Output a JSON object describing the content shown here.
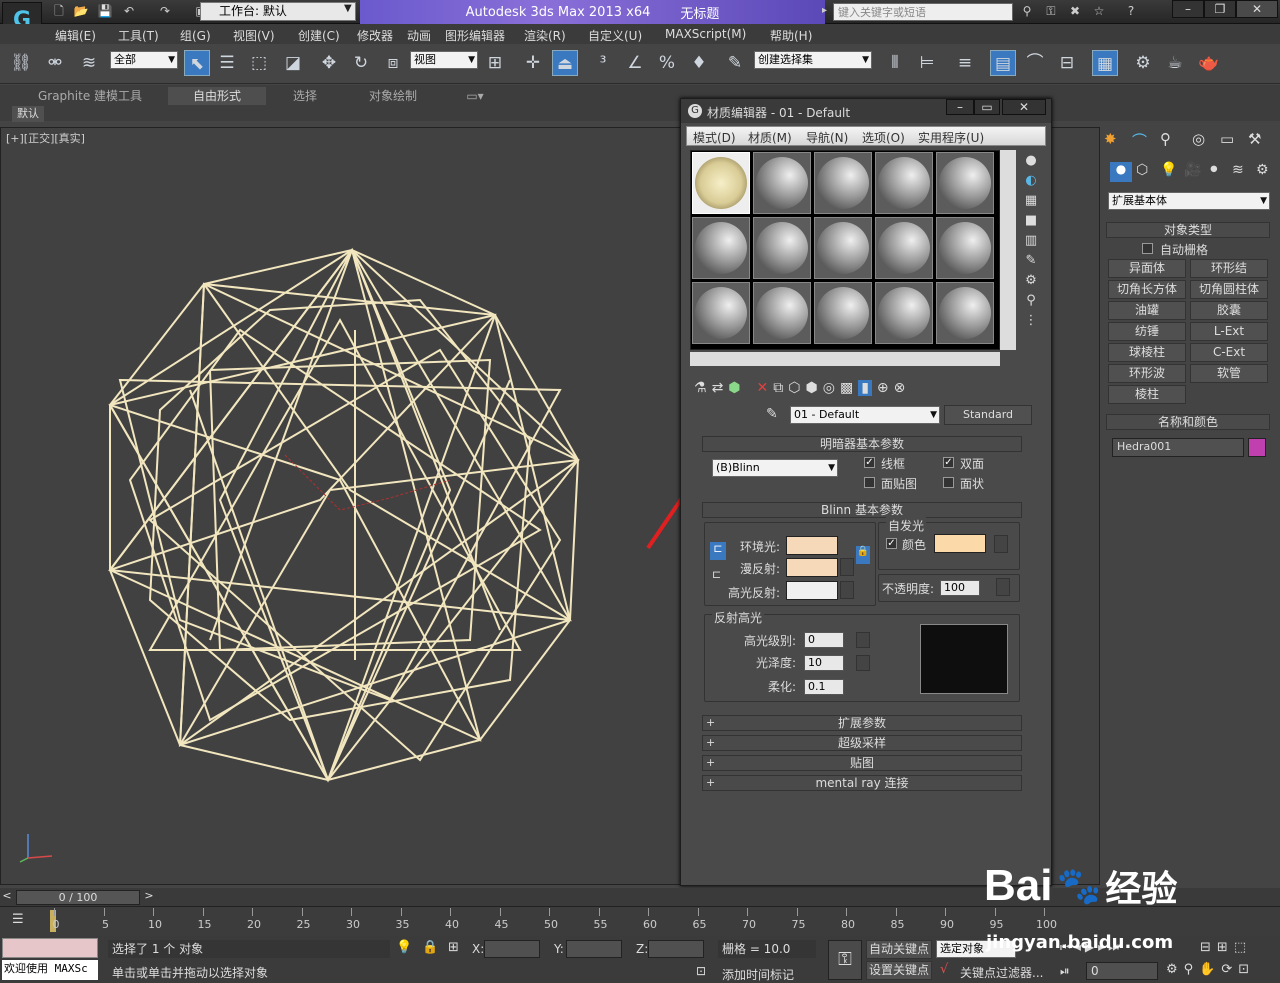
{
  "app": {
    "workspace_label": "工作台: 默认",
    "title_app": "Autodesk 3ds Max  2013 x64",
    "title_doc": "无标题",
    "search_placeholder": "键入关键字或短语"
  },
  "menu": [
    "编辑(E)",
    "工具(T)",
    "组(G)",
    "视图(V)",
    "创建(C)",
    "修改器",
    "动画",
    "图形编辑器",
    "渲染(R)",
    "自定义(U)",
    "MAXScript(M)",
    "帮助(H)"
  ],
  "toolbar": {
    "filter_value": "全部",
    "ref_coord_value": "视图",
    "selection_set_value": "创建选择集"
  },
  "ribbon": {
    "tabs": [
      "Graphite 建模工具",
      "自由形式",
      "选择",
      "对象绘制"
    ],
    "sub_label": "默认"
  },
  "viewport": {
    "label": "[+][正交][真实]"
  },
  "material_editor": {
    "title": "材质编辑器 - 01 - Default",
    "menu": [
      "模式(D)",
      "材质(M)",
      "导航(N)",
      "选项(O)",
      "实用程序(U)"
    ],
    "material_name": "01 - Default",
    "material_type": "Standard",
    "shader_rollout": "明暗器基本参数",
    "shader_value": "(B)Blinn",
    "wire_label": "线框",
    "two_sided_label": "双面",
    "face_map_label": "面贴图",
    "faceted_label": "面状",
    "blinn_rollout": "Blinn 基本参数",
    "self_illum_label": "自发光",
    "color_label": "颜色",
    "ambient_label": "环境光:",
    "diffuse_label": "漫反射:",
    "specular_label": "高光反射:",
    "opacity_label": "不透明度:",
    "opacity_value": "100",
    "spec_highlights_label": "反射高光",
    "spec_level_label": "高光级别:",
    "spec_level_value": "0",
    "glossiness_label": "光泽度:",
    "glossiness_value": "10",
    "soften_label": "柔化:",
    "soften_value": "0.1",
    "extended_rollout": "扩展参数",
    "supersampling_rollout": "超级采样",
    "maps_rollout": "贴图",
    "mentalray_rollout": "mental ray 连接",
    "colors": {
      "ambient": "#f5d9b8",
      "diffuse": "#f5d9b8",
      "specular": "#f0f0f0",
      "self_illum": "#fcd9a8"
    }
  },
  "command_panel": {
    "category_value": "扩展基本体",
    "object_type_rollout": "对象类型",
    "autogrid_label": "自动栅格",
    "buttons": [
      "异面体",
      "环形结",
      "切角长方体",
      "切角圆柱体",
      "油罐",
      "胶囊",
      "纺锤",
      "L-Ext",
      "球棱柱",
      "C-Ext",
      "环形波",
      "软管",
      "棱柱"
    ],
    "name_color_rollout": "名称和颜色",
    "object_name": "Hedra001",
    "object_color": "#c040b0"
  },
  "timeline": {
    "frame_counter": "0 / 100",
    "ticks": [
      "0",
      "5",
      "10",
      "15",
      "20",
      "25",
      "30",
      "35",
      "40",
      "45",
      "50",
      "55",
      "60",
      "65",
      "70",
      "75",
      "80",
      "85",
      "90",
      "95",
      "100"
    ]
  },
  "status": {
    "maxscript_label": "欢迎使用 MAXSc",
    "selection_text": "选择了 1 个 对象",
    "prompt_text": "单击或单击并拖动以选择对象",
    "x_label": "X:",
    "y_label": "Y:",
    "z_label": "Z:",
    "grid_text": "栅格 = 10.0",
    "add_time_tag": "添加时间标记",
    "auto_key": "自动关键点",
    "set_key": "设置关键点",
    "selected_object": "选定对象",
    "key_filters": "关键点过滤器...",
    "frame_value": "0"
  },
  "watermark": {
    "brand": "Bai",
    "brand2": "经验",
    "url": "jingyan.baidu.com"
  }
}
